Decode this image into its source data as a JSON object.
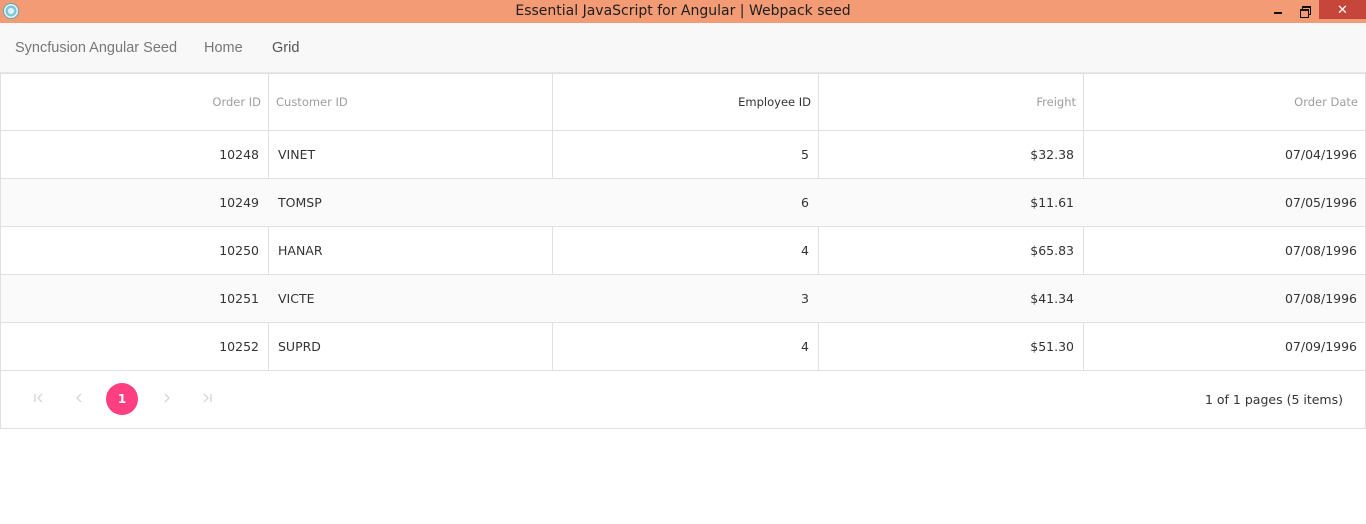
{
  "window": {
    "title": "Essential JavaScript for Angular | Webpack seed",
    "close_glyph": "✕"
  },
  "navbar": {
    "brand": "Syncfusion Angular Seed",
    "items": [
      {
        "label": "Home"
      },
      {
        "label": "Grid"
      }
    ]
  },
  "grid": {
    "columns": [
      "Order ID",
      "Customer ID",
      "Employee ID",
      "Freight",
      "Order Date"
    ],
    "rows": [
      [
        "10248",
        "VINET",
        "5",
        "$32.38",
        "07/04/1996"
      ],
      [
        "10249",
        "TOMSP",
        "6",
        "$11.61",
        "07/05/1996"
      ],
      [
        "10250",
        "HANAR",
        "4",
        "$65.83",
        "07/08/1996"
      ],
      [
        "10251",
        "VICTE",
        "3",
        "$41.34",
        "07/08/1996"
      ],
      [
        "10252",
        "SUPRD",
        "4",
        "$51.30",
        "07/09/1996"
      ]
    ]
  },
  "pager": {
    "current_page": "1",
    "info": "1 of 1 pages (5 items)"
  },
  "colors": {
    "titlebar": "#f39b74",
    "close": "#c7463c",
    "active_page": "#ff3f7f"
  }
}
